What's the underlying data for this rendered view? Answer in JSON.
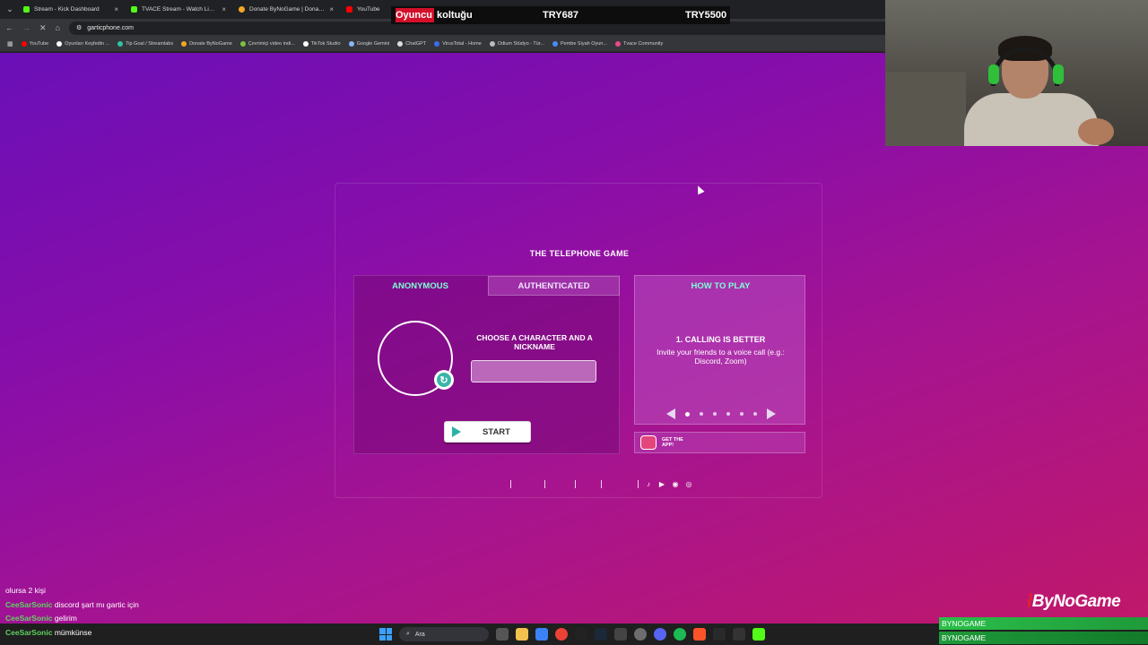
{
  "browser": {
    "tabs": [
      {
        "label": "Stream - Kick Dashboard",
        "icon": "kick-icon",
        "color": "#53fc18"
      },
      {
        "label": "TVACE Stream - Watch Live on",
        "icon": "kick-icon",
        "color": "#53fc18"
      },
      {
        "label": "Donate ByNoGame | Donations",
        "icon": "bynogame-icon",
        "color": "#f5a623"
      },
      {
        "label": "YouTube",
        "icon": "youtube-icon",
        "color": "#ff0000"
      }
    ],
    "url": "garticphone.com",
    "bookmarks": [
      {
        "label": "YouTube",
        "color": "#ff0000"
      },
      {
        "label": "Oyunları Keşfedin ...",
        "color": "#ffffff"
      },
      {
        "label": "Tip Goal / Streamlabs",
        "color": "#31c3a2"
      },
      {
        "label": "Donate ByNoGame",
        "color": "#f5a623"
      },
      {
        "label": "Çevrimiçi video indi...",
        "color": "#7cc242"
      },
      {
        "label": "TikTok Studio",
        "color": "#ffffff"
      },
      {
        "label": "Google Gemini",
        "color": "#8ab4f8"
      },
      {
        "label": "ChatGPT",
        "color": "#dddddd"
      },
      {
        "label": "VirusTotal - Home",
        "color": "#3a6df0"
      },
      {
        "label": "Odium Stüdyo - Tür...",
        "color": "#bbbbbb"
      },
      {
        "label": "Pembe Siyah Oyun...",
        "color": "#4a8df8"
      },
      {
        "label": "Tvace Community",
        "color": "#e84a8a"
      }
    ]
  },
  "overlay": {
    "seat_label_hl": "Oyuncu",
    "seat_label_rest": " koltuğu",
    "amount_1": "TRY687",
    "amount_2": "TRY5500",
    "brand": "ByNoGame",
    "brand_bar_1": "BYNOGAME",
    "brand_bar_2": "BYNOGAME"
  },
  "chat": [
    {
      "user": "",
      "user_color": "#d42a2a",
      "message": "olursa 2 kişi"
    },
    {
      "user": "CeeSarSonic",
      "user_color": "#5fd35f",
      "message": "discord şart mı gartic için"
    },
    {
      "user": "CeeSarSonic",
      "user_color": "#5fd35f",
      "message": "gelirim"
    },
    {
      "user": "CeeSarSonic",
      "user_color": "#5fd35f",
      "message": "mümkünse"
    }
  ],
  "game": {
    "title": "THE TELEPHONE GAME",
    "tabs": {
      "anonymous": "ANONYMOUS",
      "authenticated": "AUTHENTICATED"
    },
    "choose_label": "CHOOSE A CHARACTER AND A NICKNAME",
    "nickname_value": "",
    "start_label": "START",
    "how_to_play": {
      "title": "HOW TO PLAY",
      "step_title": "1. CALLING IS BETTER",
      "step_text": "Invite your friends to a voice call (e.g.: Discord, Zoom)",
      "total_steps": 6,
      "current_step": 1
    },
    "app_banner": "GET THE APP!",
    "accent_color": "#7fffd4"
  },
  "taskbar": {
    "search_label": "Ara"
  }
}
